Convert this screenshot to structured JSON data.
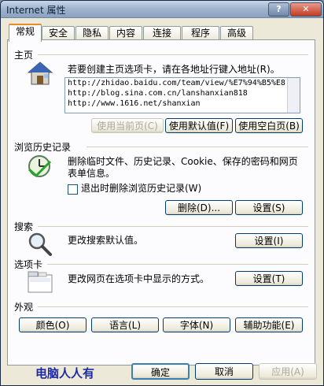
{
  "window": {
    "title": "Internet 属性",
    "help_label": "?",
    "close_label": "✕"
  },
  "tabs": [
    {
      "label": "常规"
    },
    {
      "label": "安全"
    },
    {
      "label": "隐私"
    },
    {
      "label": "内容"
    },
    {
      "label": "连接"
    },
    {
      "label": "程序"
    },
    {
      "label": "高级"
    }
  ],
  "home": {
    "title": "主页",
    "description": "若要创建主页选项卡，请在各地址行键入地址(R)。",
    "urls": [
      "http://zhidao.baidu.com/team/view/%E7%94%B5%E8",
      "http://blog.sina.com.cn/lanshanxian818",
      "http://www.1616.net/shanxian"
    ],
    "btn_current": "使用当前页(C)",
    "btn_default": "使用默认值(F)",
    "btn_blank": "使用空白页(B)"
  },
  "history": {
    "title": "浏览历史记录",
    "description_line1": "删除临时文件、历史记录、Cookie、保存的密码和网页",
    "description_line2": "表单信息。",
    "checkbox_label": "退出时删除浏览历史记录(W)",
    "btn_delete": "删除(D)...",
    "btn_settings": "设置(S)"
  },
  "search": {
    "title": "搜索",
    "description": "更改搜索默认值。",
    "btn_settings": "设置(I)"
  },
  "tabs_section": {
    "title": "选项卡",
    "description": "更改网页在选项卡中显示的方式。",
    "btn_settings": "设置(T)"
  },
  "appearance": {
    "title": "外观",
    "btn_colors": "颜色(O)",
    "btn_languages": "语言(L)",
    "btn_fonts": "字体(N)",
    "btn_accessibility": "辅助功能(E)"
  },
  "footer": {
    "brand": "电脑人人有",
    "ok": "确定",
    "cancel": "取消",
    "apply": "应用(A)"
  }
}
